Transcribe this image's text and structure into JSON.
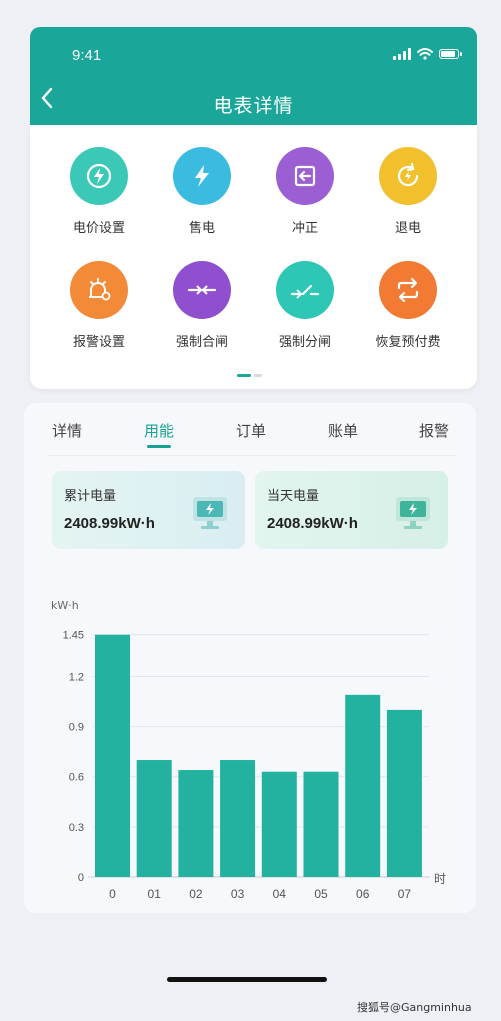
{
  "status_bar": {
    "time": "9:41"
  },
  "header": {
    "title": "电表详情",
    "back_icon": "chevron-left-icon"
  },
  "functions": [
    {
      "label": "电价设置",
      "icon": "lightning-circle-icon",
      "color": "#3cc8b6"
    },
    {
      "label": "售电",
      "icon": "lightning-icon",
      "color": "#3bbbe0"
    },
    {
      "label": "冲正",
      "icon": "reverse-icon",
      "color": "#9b5fd3"
    },
    {
      "label": "退电",
      "icon": "refund-icon",
      "color": "#f1c02c"
    },
    {
      "label": "报警设置",
      "icon": "alarm-gear-icon",
      "color": "#f38a38"
    },
    {
      "label": "强制合闸",
      "icon": "switch-close-icon",
      "color": "#8f4fcf"
    },
    {
      "label": "强制分闸",
      "icon": "switch-open-icon",
      "color": "#2ec6b4"
    },
    {
      "label": "恢复预付费",
      "icon": "cycle-icon",
      "color": "#f37a33"
    }
  ],
  "tabs": [
    {
      "label": "详情"
    },
    {
      "label": "用能",
      "active": true
    },
    {
      "label": "订单"
    },
    {
      "label": "账单"
    },
    {
      "label": "报警"
    }
  ],
  "stats": [
    {
      "label": "累计电量",
      "value": "2408.99kW·h",
      "icon": "meter-icon"
    },
    {
      "label": "当天电量",
      "value": "2408.99kW·h",
      "icon": "meter-icon"
    }
  ],
  "chart_data": {
    "type": "bar",
    "ylabel": "kW·h",
    "xlabel": "时",
    "categories": [
      "0",
      "01",
      "02",
      "03",
      "04",
      "05",
      "06",
      "07"
    ],
    "values": [
      1.45,
      0.7,
      0.64,
      0.7,
      0.63,
      0.63,
      1.09,
      1.0
    ],
    "yticks": [
      "0",
      "0.3",
      "0.6",
      "0.9",
      "1.2",
      "1.45"
    ],
    "ylim": [
      0,
      1.52
    ],
    "grid": true,
    "bar_color": "#23b29f"
  },
  "colors": {
    "primary": "#1aa79a",
    "accent": "#17a194"
  },
  "watermark": "搜狐号@Gangminhua"
}
